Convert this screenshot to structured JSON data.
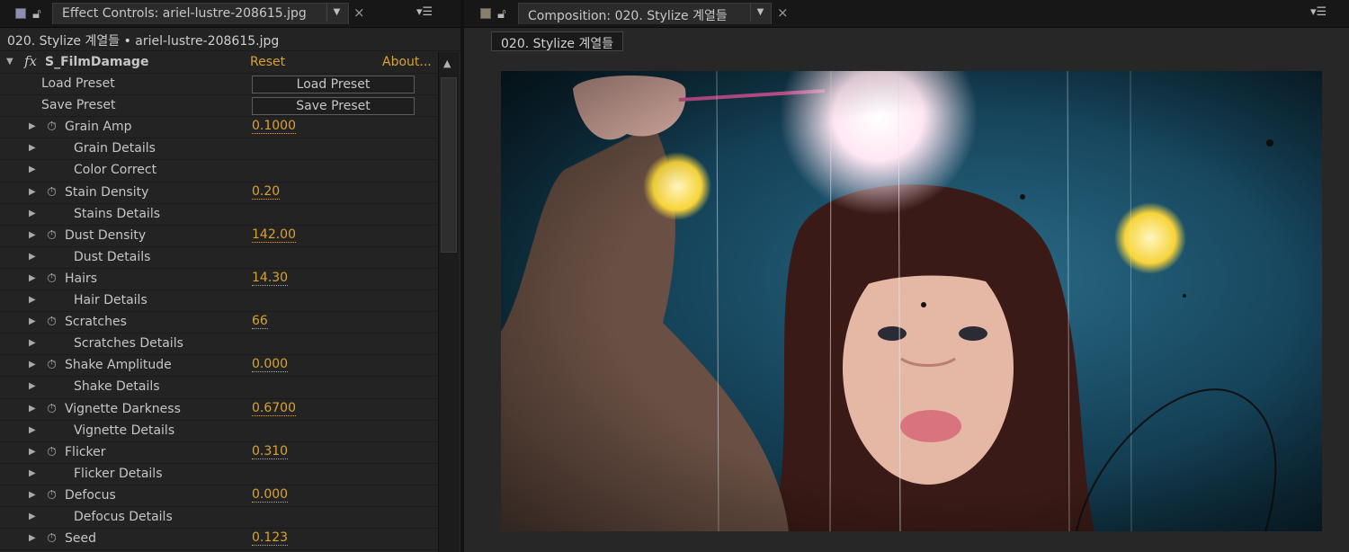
{
  "effect_controls": {
    "tab_title": "Effect Controls: ariel-lustre-208615.jpg",
    "breadcrumb": "020. Stylize 계열들 • ariel-lustre-208615.jpg",
    "effect": {
      "name": "S_FilmDamage",
      "reset_label": "Reset",
      "about_label": "About..."
    },
    "preset_rows": [
      {
        "label": "Load Preset",
        "button": "Load Preset"
      },
      {
        "label": "Save Preset",
        "button": "Save Preset"
      }
    ],
    "params": [
      {
        "label": "Grain Amp",
        "value": "0.1000",
        "kind": "param"
      },
      {
        "label": "Grain Details",
        "kind": "group"
      },
      {
        "label": "Color Correct",
        "kind": "group"
      },
      {
        "label": "Stain Density",
        "value": "0.20",
        "kind": "param"
      },
      {
        "label": "Stains Details",
        "kind": "group"
      },
      {
        "label": "Dust Density",
        "value": "142.00",
        "kind": "param"
      },
      {
        "label": "Dust Details",
        "kind": "group"
      },
      {
        "label": "Hairs",
        "value": "14.30",
        "kind": "param"
      },
      {
        "label": "Hair Details",
        "kind": "group"
      },
      {
        "label": "Scratches",
        "value": "66",
        "kind": "param"
      },
      {
        "label": "Scratches Details",
        "kind": "group"
      },
      {
        "label": "Shake Amplitude",
        "value": "0.000",
        "kind": "param"
      },
      {
        "label": "Shake Details",
        "kind": "group"
      },
      {
        "label": "Vignette Darkness",
        "value": "0.6700",
        "kind": "param"
      },
      {
        "label": "Vignette Details",
        "kind": "group"
      },
      {
        "label": "Flicker",
        "value": "0.310",
        "kind": "param"
      },
      {
        "label": "Flicker Details",
        "kind": "group"
      },
      {
        "label": "Defocus",
        "value": "0.000",
        "kind": "param"
      },
      {
        "label": "Defocus Details",
        "kind": "group"
      },
      {
        "label": "Seed",
        "value": "0.123",
        "kind": "param"
      }
    ]
  },
  "composition": {
    "tab_title": "Composition: 020. Stylize 계열들",
    "subtab": "020. Stylize 계열들"
  },
  "colors": {
    "accent_value": "#d9a330",
    "panel_bg": "#232323"
  }
}
